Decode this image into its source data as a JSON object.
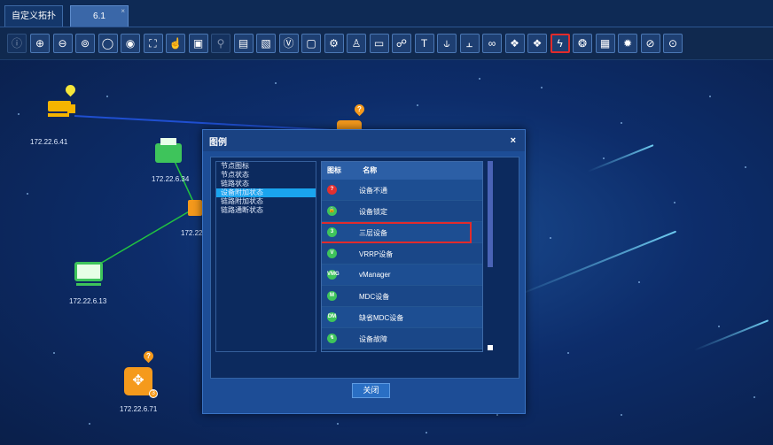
{
  "tabs": [
    {
      "label": "自定义拓扑"
    },
    {
      "label": "6.1",
      "close": "×"
    }
  ],
  "toolbar": {
    "items": [
      {
        "name": "info-icon",
        "glyph": "ⓘ",
        "disabled": true
      },
      {
        "name": "zoom-in-icon",
        "glyph": "⊕"
      },
      {
        "name": "zoom-out-icon",
        "glyph": "⊖"
      },
      {
        "name": "fit-icon",
        "glyph": "⊚"
      },
      {
        "name": "search-icon",
        "glyph": "◯"
      },
      {
        "name": "eye-icon",
        "glyph": "◉"
      },
      {
        "name": "fullscreen-icon",
        "glyph": "⛶"
      },
      {
        "name": "hand-icon",
        "glyph": "☝"
      },
      {
        "name": "select-icon",
        "glyph": "▣"
      },
      {
        "name": "link-icon",
        "glyph": "⚲",
        "disabled": true
      },
      {
        "name": "save-icon",
        "glyph": "▤"
      },
      {
        "name": "image-icon",
        "glyph": "▧"
      },
      {
        "name": "v-box-icon",
        "glyph": "Ⓥ"
      },
      {
        "name": "frame-icon",
        "glyph": "▢"
      },
      {
        "name": "settings-icon",
        "glyph": "⚙"
      },
      {
        "name": "hierarchy-icon",
        "glyph": "♙"
      },
      {
        "name": "device-icon",
        "glyph": "▭"
      },
      {
        "name": "share-icon",
        "glyph": "☍"
      },
      {
        "name": "text-icon",
        "glyph": "T"
      },
      {
        "name": "link-add-icon",
        "glyph": "⫝"
      },
      {
        "name": "link-edit-icon",
        "glyph": "⫠"
      },
      {
        "name": "binoculars-icon",
        "glyph": "∞"
      },
      {
        "name": "tag-icon",
        "glyph": "❖"
      },
      {
        "name": "tag-2-icon",
        "glyph": "❖"
      },
      {
        "name": "legend-icon",
        "glyph": "ϟ",
        "active": true
      },
      {
        "name": "palette-icon",
        "glyph": "❂"
      },
      {
        "name": "grid-icon",
        "glyph": "▦"
      },
      {
        "name": "gear-icon",
        "glyph": "✹"
      },
      {
        "name": "monitor-icon",
        "glyph": "⊘"
      },
      {
        "name": "health-icon",
        "glyph": "⊙"
      }
    ]
  },
  "topology": {
    "nodes": [
      {
        "id": "n1",
        "label": "172.22.6.41",
        "color": "#f5b400"
      },
      {
        "id": "n2",
        "label": "172.22.6.34",
        "color": "#3ec45b"
      },
      {
        "id": "n3",
        "label": "172.22",
        "color": "#f59a1c"
      },
      {
        "id": "n4",
        "label": "172.22.6.13",
        "color": "#3ec45b"
      },
      {
        "id": "n5",
        "label": "172.22.6.71",
        "color": "#f59a1c"
      },
      {
        "id": "n6",
        "label": "",
        "color": "#f59a1c"
      }
    ]
  },
  "dialog": {
    "title": "图例",
    "close_icon": "×",
    "categories": [
      {
        "label": "节点图标"
      },
      {
        "label": "节点状态"
      },
      {
        "label": "链路状态"
      },
      {
        "label": "设备附加状态",
        "selected": true
      },
      {
        "label": "链路附加状态"
      },
      {
        "label": "链路通断状态"
      }
    ],
    "legend_header": {
      "icon": "图标",
      "name": "名称"
    },
    "legend_rows": [
      {
        "icon": "?",
        "color": "#e23030",
        "name": "设备不通"
      },
      {
        "icon": "🔒",
        "color": "#3ec45b",
        "name": "设备锁定"
      },
      {
        "icon": "3",
        "color": "#3ec45b",
        "name": "三层设备",
        "highlight": true
      },
      {
        "icon": "V",
        "color": "#3ec45b",
        "name": "VRRP设备"
      },
      {
        "icon": "VMG",
        "color": "#3ec45b",
        "name": "vManager"
      },
      {
        "icon": "M",
        "color": "#3ec45b",
        "name": "MDC设备"
      },
      {
        "icon": "DM",
        "color": "#3ec45b",
        "name": "缺省MDC设备"
      },
      {
        "icon": "↯",
        "color": "#3ec45b",
        "name": "设备故障"
      }
    ],
    "close_button": "关闭"
  }
}
